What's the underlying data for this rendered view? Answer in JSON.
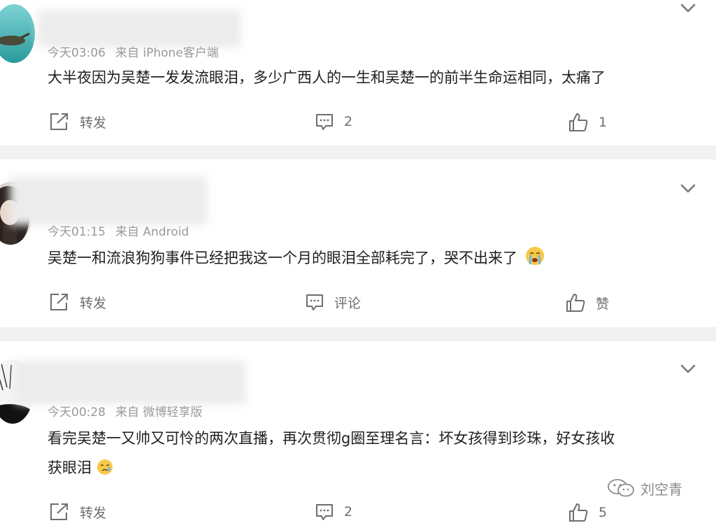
{
  "posts": [
    {
      "meta_time": "今天03:06",
      "meta_source": "来自 iPhone客户端",
      "text": "大半夜因为吴楚一发发流眼泪，多少广西人的一生和吴楚一的前半生命运相同，太痛了",
      "repost_label": "转发",
      "comment_label": "2",
      "like_label": "1",
      "avatar_icon": "sea-turtle-avatar"
    },
    {
      "meta_time": "今天01:15",
      "meta_source": "来自 Android",
      "text": "吴楚一和流浪狗狗事件已经把我这一个月的眼泪全部耗完了，哭不出来了",
      "repost_label": "转发",
      "comment_label": "评论",
      "like_label": "赞",
      "avatar_icon": "girl-portrait-avatar",
      "trailing_emoji": "crying-face-emoji"
    },
    {
      "meta_time": "今天00:28",
      "meta_source": "来自 微博轻享版",
      "text_line1": "看完吴楚一又帅又可怜的两次直播，再次贯彻g圈至理名言：坏女孩得到珍珠，好女孩收",
      "text_line2": "获眼泪",
      "repost_label": "转发",
      "comment_label": "2",
      "like_label": "5",
      "avatar_icon": "sketch-portrait-avatar",
      "trailing_emoji": "sad-tear-emoji"
    }
  ],
  "watermark": {
    "label": "刘空青",
    "icon": "wechat-icon"
  },
  "colors": {
    "text": "#1f1f1f",
    "meta": "#9a9a9a",
    "action": "#6e6e6e",
    "separator": "#f1f1f1"
  }
}
